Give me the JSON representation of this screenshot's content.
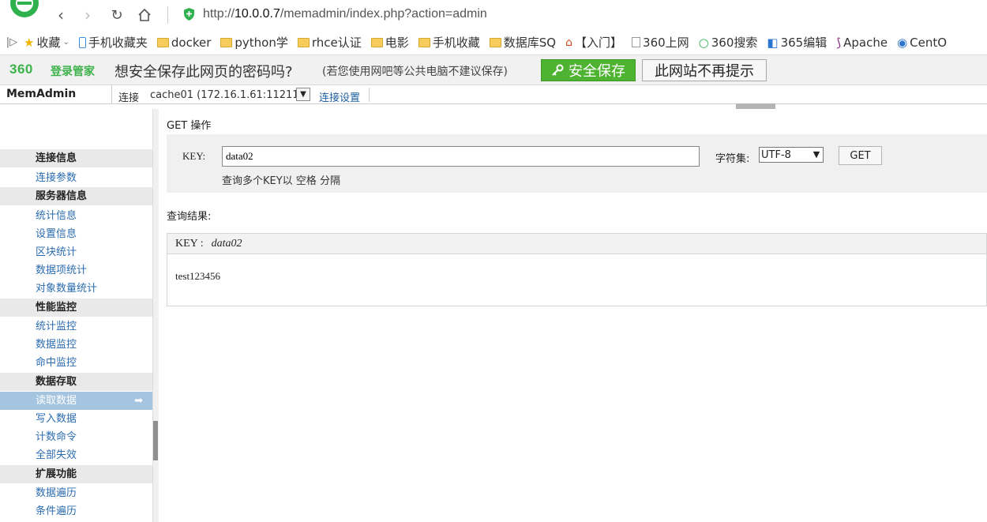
{
  "browser": {
    "url_prefix": "http://",
    "url_host": "10.0.0.7",
    "url_path": "/memadmin/index.php?action=admin"
  },
  "bookmarks": [
    {
      "label": "收藏",
      "icon": "star-icon"
    },
    {
      "label": "手机收藏夹",
      "icon": "phone-icon"
    },
    {
      "label": "docker",
      "icon": "folder-icon"
    },
    {
      "label": "python学",
      "icon": "folder-icon"
    },
    {
      "label": "rhce认证",
      "icon": "folder-icon"
    },
    {
      "label": "电影",
      "icon": "folder-icon"
    },
    {
      "label": "手机收藏",
      "icon": "folder-icon"
    },
    {
      "label": "数据库SQ",
      "icon": "folder-icon"
    },
    {
      "label": "【入门】",
      "icon": "page-icon"
    },
    {
      "label": "360上网",
      "icon": "page-icon"
    },
    {
      "label": "360搜索",
      "icon": "search-icon"
    },
    {
      "label": "365编辑",
      "icon": "page-icon"
    },
    {
      "label": "Apache",
      "icon": "feather-icon"
    },
    {
      "label": "CentO",
      "icon": "page-icon"
    }
  ],
  "password_bar": {
    "brand": "360",
    "brand_sub": "登录管家",
    "question": "想安全保存此网页的密码吗?",
    "hint": "(若您使用网吧等公共电脑不建议保存)",
    "save_label": "安全保存",
    "never_label": "此网站不再提示"
  },
  "header": {
    "title": "MemAdmin",
    "conn_label": "连接",
    "conn_value": "cache01 (172.16.1.61:11211)",
    "conn_settings": "连接设置"
  },
  "sidebar": {
    "groups": [
      {
        "title": "连接信息",
        "items": [
          "连接参数"
        ]
      },
      {
        "title": "服务器信息",
        "items": [
          "统计信息",
          "设置信息",
          "区块统计",
          "数据项统计",
          "对象数量统计"
        ]
      },
      {
        "title": "性能监控",
        "items": [
          "统计监控",
          "数据监控",
          "命中监控"
        ]
      },
      {
        "title": "数据存取",
        "items": [
          "读取数据",
          "写入数据",
          "计数命令",
          "全部失效"
        ]
      },
      {
        "title": "扩展功能",
        "items": [
          "数据遍历",
          "条件遍历"
        ]
      }
    ],
    "active_item": "读取数据"
  },
  "get_form": {
    "section_title": "GET 操作",
    "key_label": "KEY:",
    "key_value": "data02",
    "key_hint": "查询多个KEY以 空格 分隔",
    "charset_label": "字符集:",
    "charset_value": "UTF-8",
    "get_button": "GET"
  },
  "result": {
    "label": "查询结果:",
    "key_label": "KEY :",
    "key": "data02",
    "value": "test123456"
  }
}
